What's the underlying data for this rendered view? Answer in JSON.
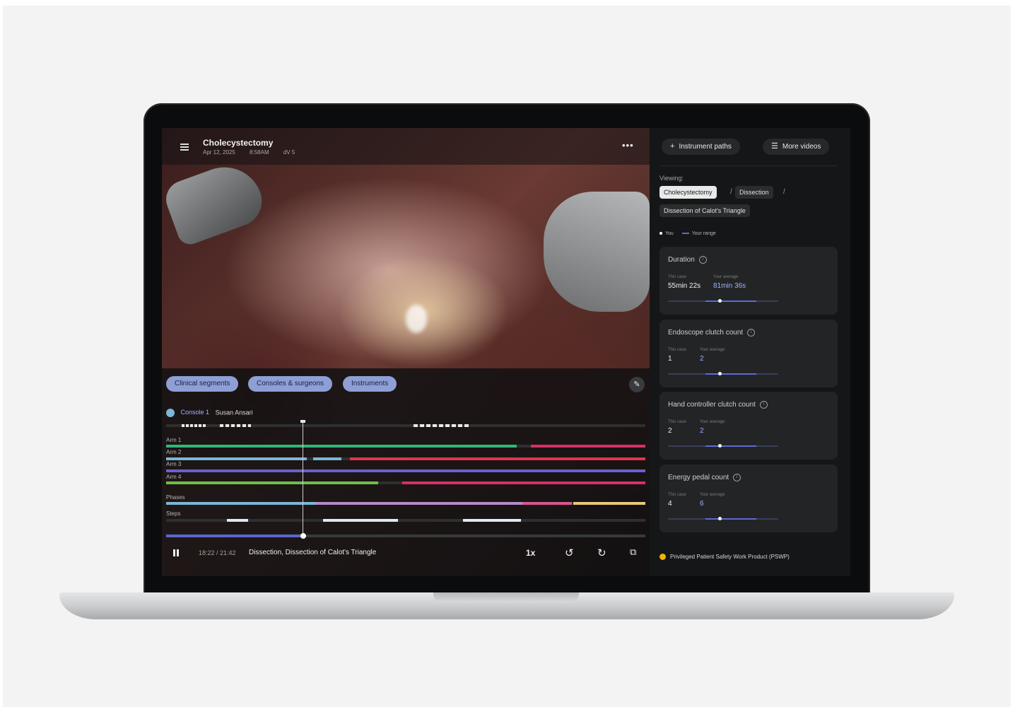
{
  "video": {
    "title": "Cholecystectomy",
    "date": "Apr 12, 2025",
    "time": "8:58AM",
    "case_index": "dV 5",
    "more_icon": "more-horizontal-icon"
  },
  "chips": [
    "Clinical segments",
    "Consoles & surgeons",
    "Instruments"
  ],
  "console": {
    "label": "Console 1",
    "surgeon": "Susan Ansari"
  },
  "tracks": {
    "arm1": "Arm 1",
    "arm2": "Arm 2",
    "arm3": "Arm 3",
    "arm4": "Arm 4",
    "phases": "Phases",
    "steps": "Steps"
  },
  "playback": {
    "progress": 0.288,
    "time": "18:22 / 21:42",
    "segment": "Dissection, Dissection of Calot's Triangle",
    "speed": "1x"
  },
  "panel": {
    "instrument_paths": "Instrument paths",
    "more_videos": "More videos",
    "viewing_label": "Viewing:",
    "crumbs": [
      "Cholecystectomy",
      "Dissection",
      "Dissection of Calot's Triangle"
    ],
    "legend_you": "You",
    "legend_range": "Your range",
    "metrics": [
      {
        "title": "Duration",
        "this_case_label": "This case",
        "avg_label": "Your average",
        "this_case": "55min 22s",
        "avg": "81min 36s",
        "you_position": 0.47,
        "range_start": 0.34,
        "range_end": 0.8
      },
      {
        "title": "Endoscope clutch count",
        "this_case_label": "This case",
        "avg_label": "Your average",
        "this_case": "1",
        "avg": "2",
        "you_position": 0.47,
        "range_start": 0.34,
        "range_end": 0.8
      },
      {
        "title": "Hand controller clutch count",
        "this_case_label": "This case",
        "avg_label": "Your average",
        "this_case": "2",
        "avg": "2",
        "you_position": 0.47,
        "range_start": 0.34,
        "range_end": 0.8
      },
      {
        "title": "Energy pedal count",
        "this_case_label": "This case",
        "avg_label": "Your average",
        "this_case": "4",
        "avg": "6",
        "you_position": 0.47,
        "range_start": 0.34,
        "range_end": 0.8
      }
    ],
    "pswp": "Privileged Patient Safety Work Product (PSWP)"
  },
  "colors": {
    "accent": "#5c6bd6",
    "chip": "#8e9fd6",
    "green": "#2fb879",
    "blue_light": "#7bb7d9",
    "red": "#e0354a",
    "pink": "#d62f6a",
    "purple": "#6b5fd1",
    "lime": "#6fbe4a",
    "mauve": "#b58ac8",
    "yellow": "#e8c978"
  }
}
